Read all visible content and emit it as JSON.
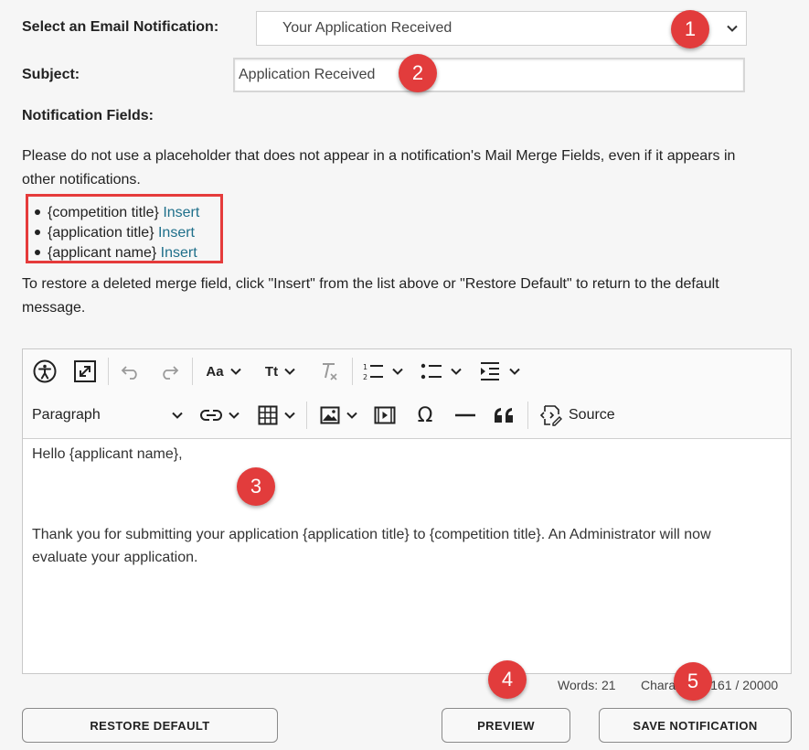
{
  "notification_select": {
    "label": "Select an Email Notification:",
    "value": "Your Application Received"
  },
  "subject": {
    "label": "Subject:",
    "value": "Application Received"
  },
  "notification_fields": {
    "heading": "Notification Fields:",
    "instruction_line1": "Please do not use a placeholder that does not appear in a notification's Mail Merge Fields, even if it appears in",
    "instruction_line2": "other notifications.",
    "fields": [
      {
        "name": "{competition title}",
        "action": "Insert"
      },
      {
        "name": "{application title}",
        "action": "Insert"
      },
      {
        "name": "{applicant name}",
        "action": "Insert"
      }
    ],
    "restore_line1": "To restore a deleted merge field, click \"Insert\" from the list above or \"Restore Default\" to return to the default",
    "restore_line2": "message."
  },
  "editor": {
    "toolbar": {
      "heading_select": "Paragraph",
      "source_label": "Source",
      "font_size_glyph": "Aa",
      "text_case_glyph": "Tt"
    },
    "content": {
      "greeting": "Hello {applicant name},",
      "body_line1": "Thank you for submitting your application {application title} to {competition title}. An Administrator will now",
      "body_line2": "evaluate your application."
    }
  },
  "counts": {
    "words": "Words: 21",
    "characters": "Characters: 161 / 20000"
  },
  "buttons": {
    "restore": "RESTORE DEFAULT",
    "preview": "PREVIEW",
    "save": "SAVE NOTIFICATION"
  },
  "markers": [
    "1",
    "2",
    "3",
    "4",
    "5"
  ],
  "colors": {
    "marker": "#e23c3c",
    "highlight_border": "#e53b3b",
    "link": "#1e6f8a"
  }
}
